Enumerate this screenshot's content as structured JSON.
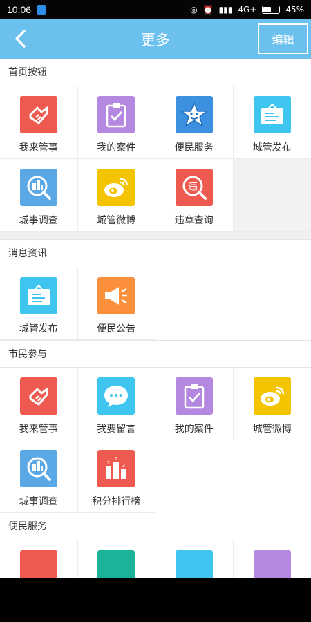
{
  "status_bar": {
    "time": "10:06",
    "network": "4G+",
    "battery": "45%"
  },
  "nav": {
    "title": "更多",
    "edit_label": "编辑"
  },
  "sections": [
    {
      "title": "首页按钮",
      "items": [
        {
          "label": "我来管事",
          "icon": "handshake-icon",
          "color": "#ee5a4f"
        },
        {
          "label": "我的案件",
          "icon": "clipboard-check-icon",
          "color": "#b488e0"
        },
        {
          "label": "便民服务",
          "icon": "star-smile-icon",
          "color": "#3d8fe0"
        },
        {
          "label": "城管发布",
          "icon": "notice-board-icon",
          "color": "#3ec6f0"
        },
        {
          "label": "城事调查",
          "icon": "city-search-icon",
          "color": "#5aa9e6"
        },
        {
          "label": "城管微博",
          "icon": "weibo-icon",
          "color": "#f5c400"
        },
        {
          "label": "违章查询",
          "icon": "violation-search-icon",
          "color": "#ee5a4f"
        }
      ]
    },
    {
      "title": "消息资讯",
      "items": [
        {
          "label": "城管发布",
          "icon": "notice-board-icon",
          "color": "#3ec6f0"
        },
        {
          "label": "便民公告",
          "icon": "megaphone-icon",
          "color": "#fb8f3c"
        }
      ]
    },
    {
      "title": "市民参与",
      "items": [
        {
          "label": "我来管事",
          "icon": "handshake-icon",
          "color": "#ee5a4f"
        },
        {
          "label": "我要留言",
          "icon": "chat-bubble-icon",
          "color": "#3ec6f0"
        },
        {
          "label": "我的案件",
          "icon": "clipboard-check-icon",
          "color": "#b488e0"
        },
        {
          "label": "城管微博",
          "icon": "weibo-icon",
          "color": "#f5c400"
        },
        {
          "label": "城事调查",
          "icon": "city-search-icon",
          "color": "#5aa9e6"
        },
        {
          "label": "积分排行榜",
          "icon": "ranking-podium-icon",
          "color": "#ee5a4f"
        }
      ]
    },
    {
      "title": "便民服务",
      "items": []
    }
  ]
}
